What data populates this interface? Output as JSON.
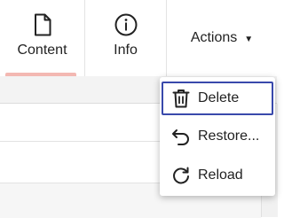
{
  "tabs": {
    "content": {
      "label": "Content",
      "icon": "document-icon"
    },
    "info": {
      "label": "Info",
      "icon": "info-icon"
    }
  },
  "actions": {
    "label": "Actions",
    "caret": "▼"
  },
  "menu": {
    "items": [
      {
        "label": "Delete",
        "icon": "trash-icon"
      },
      {
        "label": "Restore...",
        "icon": "undo-icon"
      },
      {
        "label": "Reload",
        "icon": "reload-icon"
      }
    ]
  },
  "colors": {
    "accent_underline": "#f3b8b2",
    "focus_border": "#3949ab"
  }
}
